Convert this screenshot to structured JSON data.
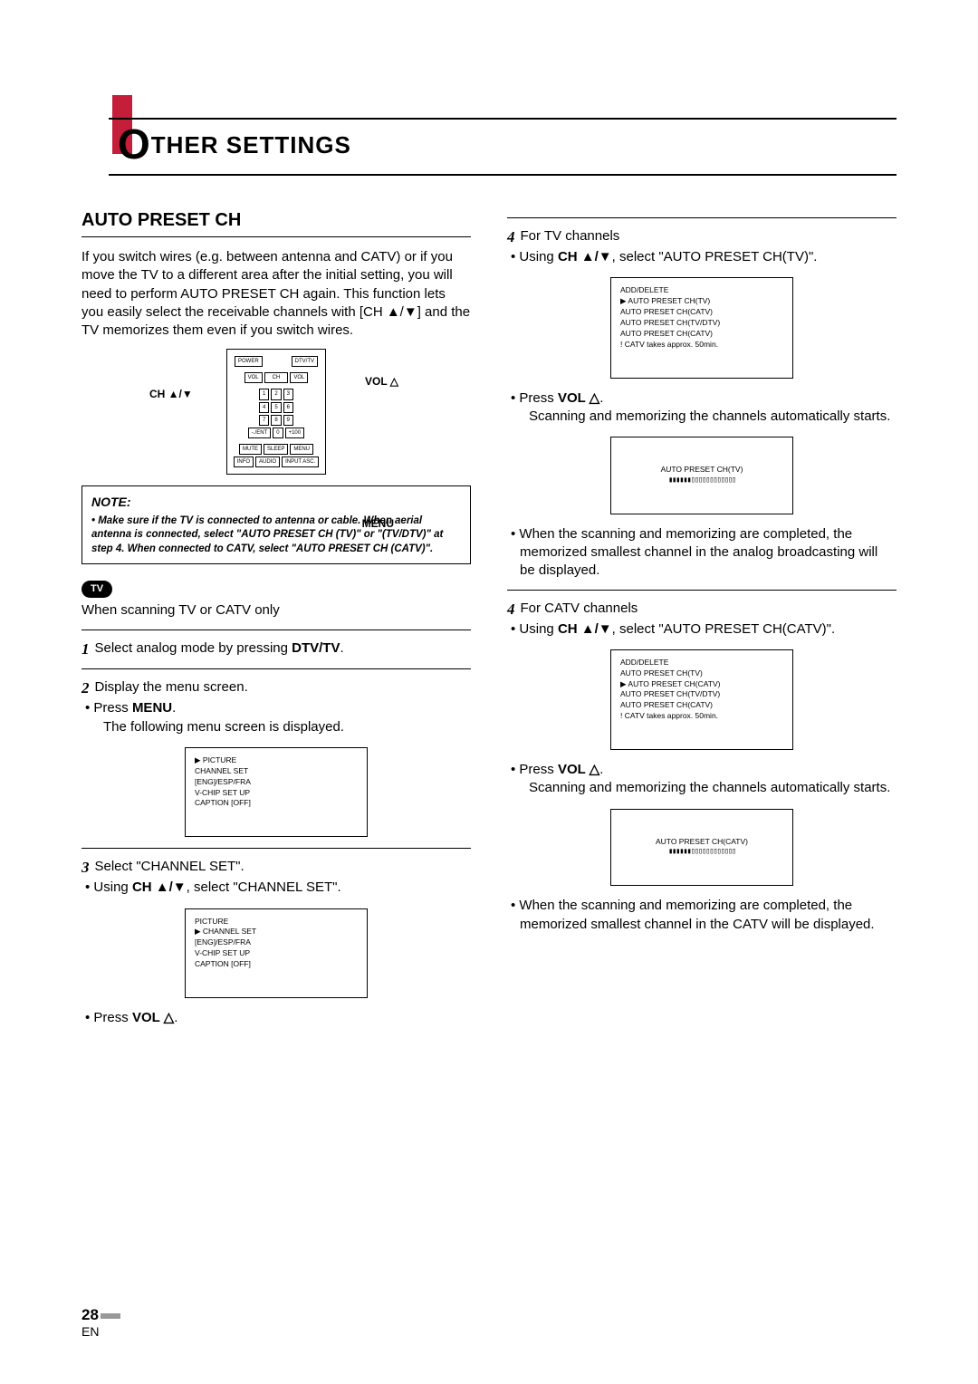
{
  "header": {
    "dropcap": "O",
    "rest": "THER SETTINGS"
  },
  "left": {
    "h2": "AUTO PRESET CH",
    "intro": "If you switch wires (e.g. between antenna and CATV) or if you move the TV to a different area after the initial setting, you will need to perform AUTO PRESET CH again. This function lets you easily select the receivable channels with [CH ▲/▼] and the TV memorizes them even if you switch wires.",
    "labels": {
      "vol": "VOL △",
      "ch": "CH ▲/▼",
      "menu": "MENU"
    },
    "remote": {
      "row0": [
        "POWER",
        "",
        "DTV/TV"
      ],
      "pad": {
        "l": "VOL",
        "c": "CH",
        "r": "VOL"
      },
      "keys": [
        [
          "1",
          "2",
          "3"
        ],
        [
          "4",
          "5",
          "6"
        ],
        [
          "7",
          "8",
          "9"
        ],
        [
          "-./ENT",
          "0",
          "+100"
        ]
      ],
      "rowF": [
        "MUTE",
        "SLEEP",
        "MENU"
      ],
      "rowG": [
        "INFO",
        "AUDIO",
        "INPUT ASC."
      ]
    },
    "note": {
      "title": "NOTE:",
      "text": "• Make sure if the TV is connected to antenna or cable. When aerial antenna is connected, select \"AUTO PRESET CH (TV)\" or \"(TV/DTV)\" at step 4.  When connected to CATV, select \"AUTO PRESET CH (CATV)\"."
    },
    "tvTag": "TV",
    "lead": "When scanning TV or CATV only",
    "s1": {
      "n": "1",
      "t": "Select analog mode by pressing ",
      "b": "DTV/TV",
      "t2": "."
    },
    "s2": {
      "n": "2",
      "t": "Display the menu screen.",
      "b1": "• Press ",
      "b1b": "MENU",
      "b1t": ".",
      "b2": "The following menu screen is displayed."
    },
    "menu1": [
      "▶ PICTURE",
      "   CHANNEL SET",
      "   [ENG]/ESP/FRA",
      "   V-CHIP SET UP",
      "   CAPTION [OFF]"
    ],
    "s3": {
      "n": "3",
      "t": "Select \"CHANNEL SET\".",
      "b": "• Using ",
      "bb": "CH ▲/▼",
      "bt": ", select \"CHANNEL SET\"."
    },
    "menu2": [
      "   PICTURE",
      "▶ CHANNEL SET",
      "   [ENG]/ESP/FRA",
      "   V-CHIP SET UP",
      "   CAPTION [OFF]"
    ],
    "s3b": {
      "t": "• Press ",
      "b": "VOL △",
      "t2": "."
    }
  },
  "right": {
    "s4a": {
      "n": "4",
      "t": "For TV channels",
      "b": "• Using ",
      "bb": "CH ▲/▼",
      "bt": ", select \"AUTO PRESET CH(TV)\"."
    },
    "menu3": [
      "   ADD/DELETE",
      "▶ AUTO PRESET CH(TV)",
      "   AUTO PRESET CH(CATV)",
      "   AUTO PRESET CH(TV/DTV)",
      "   AUTO PRESET CH(CATV)",
      "! CATV takes approx. 50min."
    ],
    "s4a2": {
      "t": "• Press ",
      "b": "VOL △",
      "t2": ".",
      "t3": "Scanning and memorizing the channels automatically starts."
    },
    "scan1": {
      "title": "AUTO PRESET CH(TV)",
      "bar": "▮▮▮▮▮▮▯▯▯▯▯▯▯▯▯▯▯▯"
    },
    "s4a3": "• When the scanning and memorizing are completed, the memorized smallest channel in the analog broadcasting will be displayed.",
    "s4b": {
      "n": "4",
      "t": "For CATV channels",
      "b": "• Using ",
      "bb": "CH ▲/▼",
      "bt": ", select \"AUTO PRESET CH(CATV)\"."
    },
    "menu4": [
      "   ADD/DELETE",
      "   AUTO PRESET CH(TV)",
      "▶ AUTO PRESET CH(CATV)",
      "   AUTO PRESET CH(TV/DTV)",
      "   AUTO PRESET CH(CATV)",
      "! CATV takes approx. 50min."
    ],
    "s4b2": {
      "t": "• Press ",
      "b": "VOL △",
      "t2": ".",
      "t3": "Scanning and memorizing the channels automatically starts."
    },
    "scan2": {
      "title": "AUTO PRESET CH(CATV)",
      "bar": "▮▮▮▮▮▮▯▯▯▯▯▯▯▯▯▯▯▯"
    },
    "s4b3": "• When the scanning and memorizing are completed, the memorized smallest channel in the CATV will be displayed."
  },
  "footer": {
    "num": "28",
    "lang": "EN"
  }
}
